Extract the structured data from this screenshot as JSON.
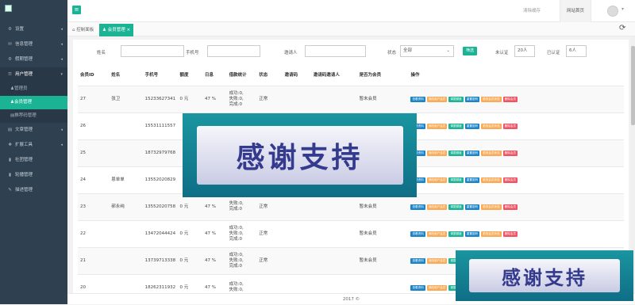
{
  "sidebar": {
    "items": [
      {
        "icon": "⚙",
        "label": "设置",
        "caret": "◂"
      },
      {
        "icon": "✉",
        "label": "信息管理",
        "caret": "◂"
      },
      {
        "icon": "⚙",
        "label": "假期管理",
        "caret": "◂"
      },
      {
        "icon": "☰",
        "label": "用户管理",
        "caret": "▾"
      },
      {
        "icon": "♟",
        "label": "管理员",
        "sub": true
      },
      {
        "icon": "♟",
        "label": "会员管理",
        "sub": true,
        "active": true
      },
      {
        "icon": "▤",
        "label": "推荐码管理",
        "sub": true
      },
      {
        "icon": "▤",
        "label": "文章管理",
        "caret": "◂"
      },
      {
        "icon": "✚",
        "label": "扩展工具",
        "caret": "◂"
      },
      {
        "icon": "▮",
        "label": "社团管理"
      },
      {
        "icon": "▮",
        "label": "轮播管理"
      },
      {
        "icon": "✎",
        "label": "描述管理"
      }
    ]
  },
  "topbar": {
    "menu_icon": "≡",
    "clear_cache": "清除缓存",
    "site_home": "网站首页",
    "avatar_caret": "▾"
  },
  "tabs": {
    "dashboard_icon": "⌂",
    "dashboard": "控制面板",
    "members_icon": "♟",
    "members": "会员管理",
    "close": "×",
    "refresh_icon": "⟳"
  },
  "filters": {
    "name": "姓名",
    "phone": "手机号",
    "inviter": "邀请人",
    "status": "状态",
    "status_value": "全部",
    "status_caret": "⌄",
    "search": "筛选",
    "unverified": "未认证",
    "unverified_count": "20人",
    "verified": "已认证",
    "verified_count": "6人"
  },
  "table": {
    "headers": [
      "会员ID",
      "姓名",
      "手机号",
      "额度",
      "日息",
      "借款统计",
      "状态",
      "邀请码",
      "邀请码邀请人",
      "是否为会员",
      "操作"
    ],
    "rows": [
      {
        "id": "27",
        "name": "张卫",
        "phone": "15233627341",
        "quota": "0 元",
        "rate": "47 %",
        "stats": [
          "成功:0,",
          "失败:0,",
          "完成:0"
        ],
        "status": "正常",
        "code": "",
        "inviter": "",
        "member": "暂未会员"
      },
      {
        "id": "26",
        "name": "",
        "phone": "15531111557",
        "quota": "",
        "rate": "",
        "stats": [],
        "status": "",
        "code": "",
        "inviter": "",
        "member": ""
      },
      {
        "id": "25",
        "name": "",
        "phone": "18732979768",
        "quota": "",
        "rate": "",
        "stats": [],
        "status": "",
        "code": "",
        "inviter": "",
        "member": ""
      },
      {
        "id": "24",
        "name": "恩单单",
        "phone": "13552020829",
        "quota": "",
        "rate": "",
        "stats": [],
        "status": "",
        "code": "",
        "inviter": "",
        "member": ""
      },
      {
        "id": "23",
        "name": "郝永纯",
        "phone": "13552020758",
        "quota": "0 元",
        "rate": "47 %",
        "stats": [
          "",
          "失败:0,",
          "完成:0"
        ],
        "status": "正常",
        "code": "",
        "inviter": "",
        "member": "暂未会员"
      },
      {
        "id": "22",
        "name": "",
        "phone": "13472044424",
        "quota": "0 元",
        "rate": "47 %",
        "stats": [
          "成功:0,",
          "失败:0,",
          "完成:0"
        ],
        "status": "正常",
        "code": "",
        "inviter": "",
        "member": "暂未会员"
      },
      {
        "id": "21",
        "name": "",
        "phone": "13739713338",
        "quota": "0 元",
        "rate": "47 %",
        "stats": [
          "成功:0,",
          "失败:0,",
          "完成:0"
        ],
        "status": "正常",
        "code": "",
        "inviter": "",
        "member": "暂未会员"
      },
      {
        "id": "20",
        "name": "",
        "phone": "18262311932",
        "quota": "0 元",
        "rate": "47 %",
        "stats": [
          "成功:0,",
          "失败:0,"
        ],
        "status": "",
        "code": "",
        "inviter": "",
        "member": ""
      }
    ],
    "ops": [
      "查看资料",
      "修改用户会员",
      "调整额度",
      "重置密码",
      "更改会员状态",
      "删除会员"
    ]
  },
  "footer": "2017 ©",
  "overlays": {
    "large": "感谢支持",
    "small": "感谢支持"
  },
  "colors": {
    "sidebar": "#2f4050",
    "accent": "#1ab394",
    "blue": "#1c84c6",
    "orange": "#f8ac59",
    "red": "#ed5565"
  }
}
